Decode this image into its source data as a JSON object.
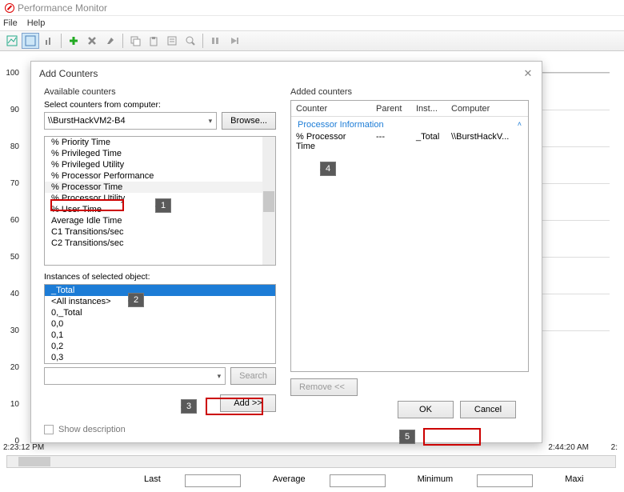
{
  "app": {
    "title": "Performance Monitor"
  },
  "menu": {
    "file": "File",
    "help": "Help"
  },
  "dialog": {
    "title": "Add Counters",
    "available_label": "Available counters",
    "select_from_label": "Select counters from computer:",
    "computer": "\\\\BurstHackVM2-B4",
    "browse": "Browse...",
    "counters": [
      "% Priority Time",
      "% Privileged Time",
      "% Privileged Utility",
      "% Processor Performance",
      "% Processor Time",
      "% Processor Utility",
      "% User Time",
      "Average Idle Time",
      "C1 Transitions/sec",
      "C2 Transitions/sec"
    ],
    "instances_label": "Instances of selected object:",
    "instances": [
      "_Total",
      "<All instances>",
      "0,_Total",
      "0,0",
      "0,1",
      "0,2",
      "0,3"
    ],
    "search": "Search",
    "add": "Add >>",
    "show_desc": "Show description",
    "added_label": "Added counters",
    "grid_head": {
      "counter": "Counter",
      "parent": "Parent",
      "inst": "Inst...",
      "computer": "Computer"
    },
    "group": "Processor Information",
    "row": {
      "counter": "% Processor Time",
      "parent": "---",
      "inst": "_Total",
      "computer": "\\\\BurstHackV..."
    },
    "remove": "Remove <<",
    "ok": "OK",
    "cancel": "Cancel"
  },
  "callouts": {
    "c1": "1",
    "c2": "2",
    "c3": "3",
    "c4": "4",
    "c5": "5"
  },
  "chart": {
    "yticks": [
      "100",
      "90",
      "80",
      "70",
      "60",
      "50",
      "40",
      "30",
      "20",
      "10",
      "0"
    ],
    "time1": "2:23:12 PM",
    "time2": "2:44:20 AM",
    "stats": {
      "last": "Last",
      "average": "Average",
      "minimum": "Minimum",
      "maximum": "Maxi"
    }
  }
}
